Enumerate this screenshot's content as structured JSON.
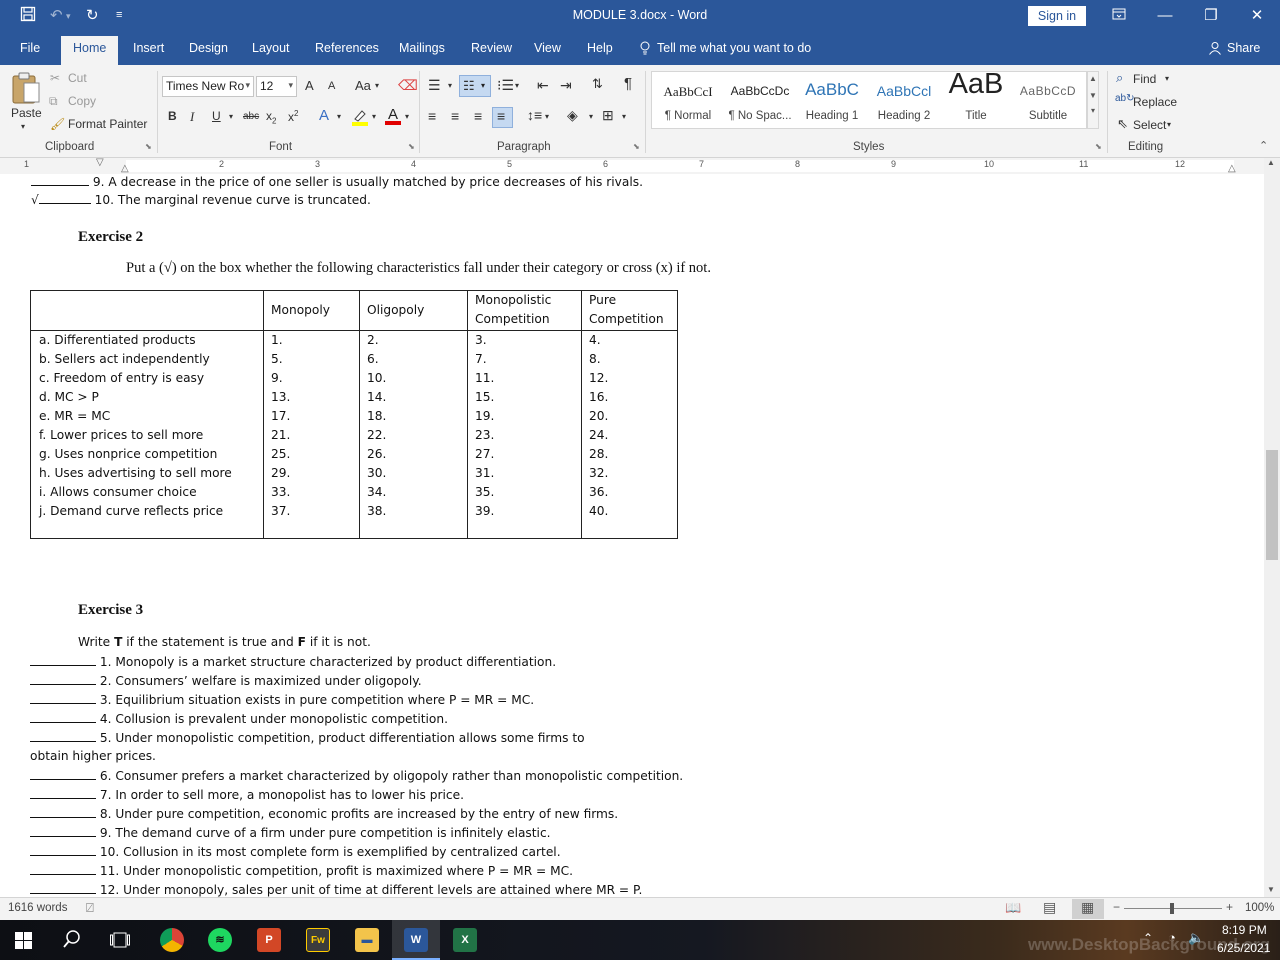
{
  "window": {
    "title": "MODULE 3.docx  -  Word",
    "sign_in": "Sign in"
  },
  "tabs": [
    "File",
    "Home",
    "Insert",
    "Design",
    "Layout",
    "References",
    "Mailings",
    "Review",
    "View",
    "Help"
  ],
  "tell_me": "Tell me what you want to do",
  "share": "Share",
  "ribbon": {
    "clipboard": {
      "paste": "Paste",
      "cut": "Cut",
      "copy": "Copy",
      "format_painter": "Format Painter",
      "label": "Clipboard"
    },
    "font": {
      "name": "Times New Ro",
      "size": "12",
      "label": "Font",
      "case": "Aa",
      "grow": "A",
      "shrink": "A"
    },
    "paragraph": {
      "label": "Paragraph"
    },
    "styles": {
      "label": "Styles",
      "items": [
        {
          "preview": "AaBbCcI",
          "name": "¶ Normal"
        },
        {
          "preview": "AaBbCcDc",
          "name": "¶ No Spac..."
        },
        {
          "preview": "AaBbC",
          "name": "Heading 1"
        },
        {
          "preview": "AaBbCcl",
          "name": "Heading 2"
        },
        {
          "preview": "AaB",
          "name": "Title"
        },
        {
          "preview": "AaBbCcD",
          "name": "Subtitle"
        }
      ]
    },
    "editing": {
      "find": "Find",
      "replace": "Replace",
      "select": "Select",
      "label": "Editing"
    }
  },
  "ruler": {
    "numbers": [
      "1",
      "2",
      "3",
      "4",
      "5",
      "6",
      "7",
      "8",
      "9",
      "10",
      "11",
      "12"
    ]
  },
  "document": {
    "top_line_9": "9. A decrease in the price of one seller is usually matched by price decreases of his rivals.",
    "top_line_10": "10. The marginal revenue curve is truncated.",
    "check_mark": "√",
    "exercise2_title": "Exercise 2",
    "exercise2_instructions": "Put a (√) on the box whether the following characteristics fall under their category or cross (x) if not.",
    "table": {
      "headers": [
        {
          "line1": "Monopoly",
          "line2": ""
        },
        {
          "line1": "Oligopoly",
          "line2": ""
        },
        {
          "line1": "Monopolistic",
          "line2": "Competition"
        },
        {
          "line1": "Pure",
          "line2": "Competition"
        }
      ],
      "rows": [
        {
          "label": "a. Differentiated products",
          "cells": [
            "1.",
            "2.",
            "3.",
            "4."
          ]
        },
        {
          "label": "b. Sellers act independently",
          "cells": [
            "5.",
            "6.",
            "7.",
            "8."
          ]
        },
        {
          "label": "c. Freedom of entry is easy",
          "cells": [
            "9.",
            "10.",
            "11.",
            "12."
          ]
        },
        {
          "label": "d. MC > P",
          "cells": [
            "13.",
            "14.",
            "15.",
            "16."
          ]
        },
        {
          "label": "e. MR = MC",
          "cells": [
            "17.",
            "18.",
            "19.",
            "20."
          ]
        },
        {
          "label": "f. Lower prices to sell more",
          "cells": [
            "21.",
            "22.",
            "23.",
            "24."
          ]
        },
        {
          "label": "g. Uses nonprice competition",
          "cells": [
            "25.",
            "26.",
            "27.",
            "28."
          ]
        },
        {
          "label": "h. Uses advertising to sell more",
          "cells": [
            "29.",
            "30.",
            "31.",
            "32."
          ]
        },
        {
          "label": "i. Allows consumer choice",
          "cells": [
            "33.",
            "34.",
            "35.",
            "36."
          ]
        },
        {
          "label": "j. Demand curve reflects price",
          "cells": [
            "37.",
            "38.",
            "39.",
            "40."
          ]
        }
      ]
    },
    "exercise3_title": "Exercise 3",
    "exercise3_intro_pre": "Write ",
    "exercise3_intro_t": "T",
    "exercise3_intro_mid": " if the statement is true and ",
    "exercise3_intro_f": "F",
    "exercise3_intro_post": " if it is not.",
    "statements": [
      "1. Monopoly is a market structure characterized by product differentiation.",
      "2. Consumers’ welfare is maximized under oligopoly.",
      "3. Equilibrium situation exists in pure competition where P = MR = MC.",
      "4. Collusion is prevalent under monopolistic competition.",
      "5. Under monopolistic competition, product differentiation allows some firms to",
      "6. Consumer prefers a market characterized by oligopoly rather than monopolistic competition.",
      "7. In order to sell more, a monopolist has to lower his price.",
      "8. Under pure competition, economic profits are increased by the entry of new firms.",
      "9. The demand curve of a firm under pure competition is infinitely elastic.",
      "10. Collusion in its most complete form is exemplified by centralized cartel.",
      "11. Under monopolistic competition, profit is maximized where P = MR = MC.",
      "12. Under monopoly, sales per unit of time at different levels are attained where MR = P."
    ],
    "statement5_continuation": "obtain higher prices."
  },
  "status": {
    "words": "1616 words",
    "zoom": "100%"
  },
  "taskbar": {
    "time": "8:19 PM",
    "date": "6/25/2021",
    "watermark": "www.DesktopBackground.org"
  },
  "colors": {
    "word_blue": "#2b579a",
    "ribbon_bg": "#f3f3f3"
  }
}
